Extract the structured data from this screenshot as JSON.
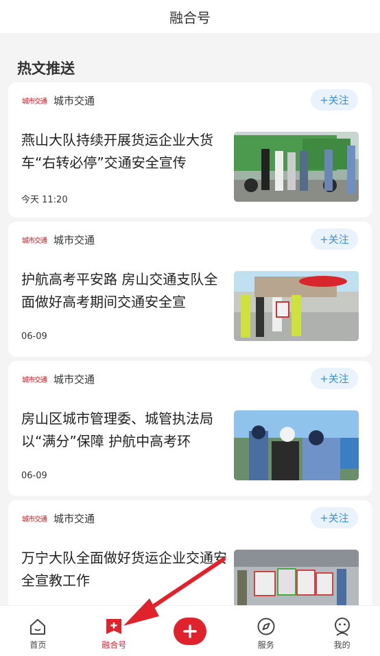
{
  "header": {
    "title": "融合号"
  },
  "section": {
    "title": "热文推送"
  },
  "cards": [
    {
      "source_logo": "城市交通",
      "source": "城市交通",
      "follow": "+关注",
      "headline": "燕山大队持续开展货运企业大货车“右转必停”交通安全宣传",
      "time": "今天 11:20",
      "image": "photo-trucks"
    },
    {
      "source_logo": "城市交通",
      "source": "城市交通",
      "follow": "+关注",
      "headline": "护航高考平安路 房山交通支队全面做好高考期间交通安全宣",
      "time": "06-09",
      "image": "photo-exam-site"
    },
    {
      "source_logo": "城市交通",
      "source": "城市交通",
      "follow": "+关注",
      "headline": "房山区城市管理委、城管执法局以“满分”保障 护航中高考环",
      "time": "06-09",
      "image": "photo-officers"
    },
    {
      "source_logo": "城市交通",
      "source": "城市交通",
      "follow": "+关注",
      "headline": "万宁大队全面做好货运企业交通安全宣教工作",
      "time": "",
      "image": "photo-group"
    }
  ],
  "tabbar": {
    "items": [
      {
        "label": "首页",
        "icon": "home-icon"
      },
      {
        "label": "融合号",
        "icon": "bookmark-plus-icon",
        "active": true
      },
      {
        "label": "",
        "icon": "plus-icon"
      },
      {
        "label": "服务",
        "icon": "compass-icon"
      },
      {
        "label": "我的",
        "icon": "profile-icon"
      }
    ]
  },
  "colors": {
    "accent": "#e0222c",
    "follow_bg": "#eaf3fb",
    "follow_text": "#3a8fd6"
  }
}
